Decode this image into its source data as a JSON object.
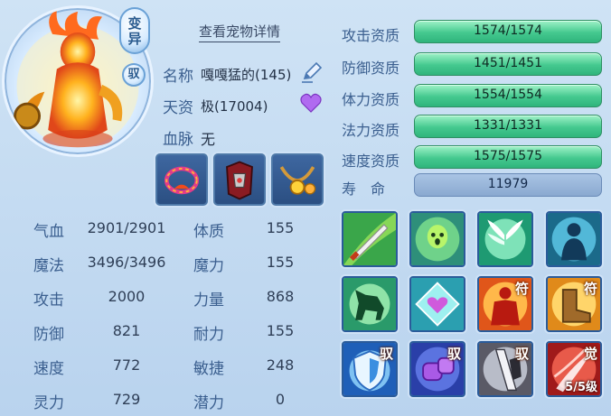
{
  "pet": {
    "tags": {
      "variant": "变\n异",
      "bind": "驭"
    },
    "detail_link": "查看宠物详情",
    "name_label": "名称",
    "name_value": "嘎嘎猛的(145)",
    "aptitude_label": "天资",
    "aptitude_value": "极(17004)",
    "bloodline_label": "血脉",
    "bloodline_value": "无",
    "icons": {
      "edit": "pencil-icon",
      "favorite": "heart-icon"
    },
    "equipment": [
      "collar-icon",
      "armor-icon",
      "necklace-icon"
    ]
  },
  "attributes": [
    {
      "label": "气血",
      "value": "2901/2901",
      "label2": "体质",
      "value2": "155"
    },
    {
      "label": "魔法",
      "value": "3496/3496",
      "label2": "魔力",
      "value2": "155"
    },
    {
      "label": "攻击",
      "value": "2000",
      "label2": "力量",
      "value2": "868"
    },
    {
      "label": "防御",
      "value": "821",
      "label2": "耐力",
      "value2": "155"
    },
    {
      "label": "速度",
      "value": "772",
      "label2": "敏捷",
      "value2": "248"
    },
    {
      "label": "灵力",
      "value": "729",
      "label2": "潜力",
      "value2": "0"
    }
  ],
  "aptitudes": [
    {
      "label": "攻击资质",
      "value": "1574/1574"
    },
    {
      "label": "防御资质",
      "value": "1451/1451"
    },
    {
      "label": "体力资质",
      "value": "1554/1554"
    },
    {
      "label": "法力资质",
      "value": "1331/1331"
    },
    {
      "label": "速度资质",
      "value": "1575/1575"
    }
  ],
  "lifespan": {
    "label": "寿　命",
    "value": "11979"
  },
  "skills": [
    {
      "name": "sword-strike-icon",
      "badge": ""
    },
    {
      "name": "ghost-spirit-icon",
      "badge": ""
    },
    {
      "name": "wings-icon",
      "badge": ""
    },
    {
      "name": "shadow-figure-icon",
      "badge": ""
    },
    {
      "name": "horse-icon",
      "badge": ""
    },
    {
      "name": "heart-shield-icon",
      "badge": ""
    },
    {
      "name": "red-figure-icon",
      "badge": "符"
    },
    {
      "name": "boot-icon",
      "badge": "符"
    },
    {
      "name": "shield-icon",
      "badge": "驭"
    },
    {
      "name": "purple-fist-icon",
      "badge": "驭"
    },
    {
      "name": "sword-dark-icon",
      "badge": "驭"
    },
    {
      "name": "awaken-icon",
      "badge": "觉",
      "level": "5/5级"
    }
  ]
}
